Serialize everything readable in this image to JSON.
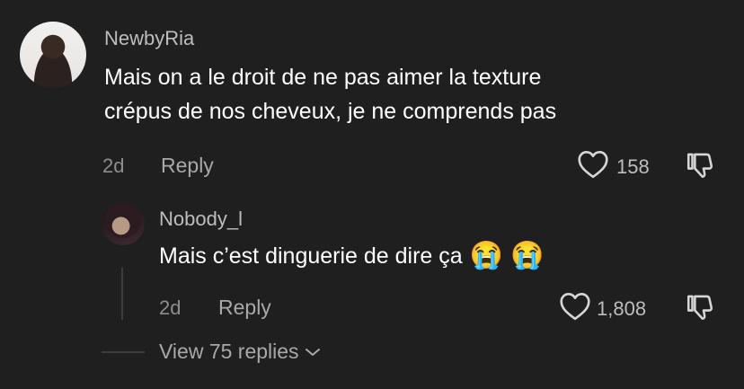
{
  "comment": {
    "username": "NewbyRia",
    "text_line1": "Mais on a le droit de ne pas aimer la texture",
    "text_line2": "crépus de nos cheveux, je ne comprends pas",
    "age": "2d",
    "reply_label": "Reply",
    "like_count": "158",
    "icons": {
      "like": "heart-outline-icon",
      "dislike": "thumbs-down-icon"
    }
  },
  "reply": {
    "username": "Nobody_l",
    "text": "Mais c’est dinguerie de dire ça",
    "emojis": [
      "😭",
      "😭"
    ],
    "age": "2d",
    "reply_label": "Reply",
    "like_count": "1,808",
    "icons": {
      "like": "heart-outline-icon",
      "dislike": "thumbs-down-icon"
    }
  },
  "view_replies": {
    "label": "View 75 replies",
    "icon": "chevron-down-icon"
  },
  "colors": {
    "background": "#1f1f1f",
    "text": "#ffffff",
    "secondary": "#a8a8a8"
  }
}
